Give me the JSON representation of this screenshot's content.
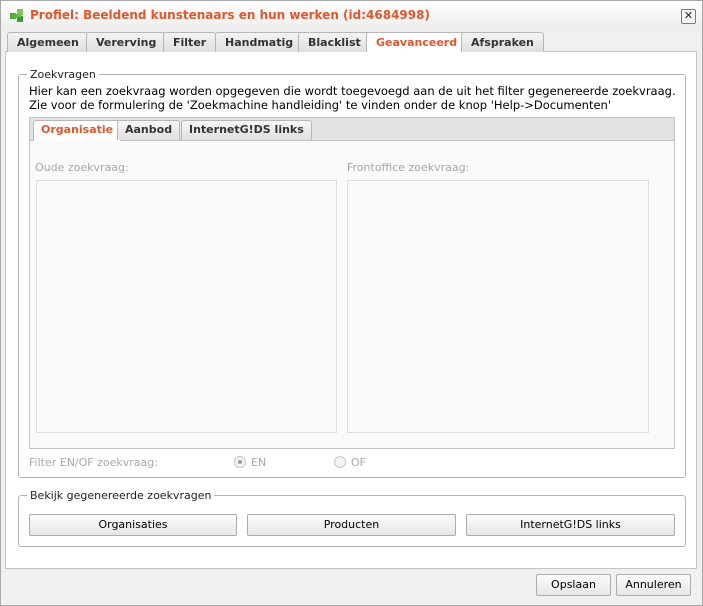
{
  "window": {
    "title": "Profiel: Beeldend kunstenaars en hun werken (id:4684998)",
    "close_label": "✕"
  },
  "tabs": [
    {
      "label": "Algemeen",
      "active": false
    },
    {
      "label": "Vererving",
      "active": false
    },
    {
      "label": "Filter",
      "active": false
    },
    {
      "label": "Handmatig",
      "active": false
    },
    {
      "label": "Blacklist",
      "active": false
    },
    {
      "label": "Geavanceerd",
      "active": true
    },
    {
      "label": "Afspraken",
      "active": false
    }
  ],
  "zoekvragen": {
    "legend": "Zoekvragen",
    "description": "Hier kan een zoekvraag worden opgegeven die wordt toegevoegd aan de uit het filter gegenereerde zoekvraag. Zie voor de formulering de 'Zoekmachine handleiding' te vinden onder de knop 'Help->Documenten'",
    "subtabs": [
      {
        "label": "Organisatie",
        "active": true
      },
      {
        "label": "Aanbod",
        "active": false
      },
      {
        "label": "InternetG!DS links",
        "active": false
      }
    ],
    "oude_label": "Oude zoekvraag:",
    "oude_value": "",
    "frontoffice_label": "Frontoffice zoekvraag:",
    "frontoffice_value": "",
    "filter_label": "Filter EN/OF zoekvraag:",
    "option_en": "EN",
    "option_of": "OF",
    "selected": "EN"
  },
  "generated": {
    "legend": "Bekijk gegenereerde zoekvragen",
    "buttons": [
      "Organisaties",
      "Producten",
      "InternetG!DS links"
    ]
  },
  "footer": {
    "save_label": "Opslaan",
    "cancel_label": "Annuleren"
  },
  "colors": {
    "accent": "#e2562c",
    "disabled_text": "#a8a8a8"
  },
  "icons": {
    "app": "puzzle-icon",
    "close": "close-icon"
  }
}
